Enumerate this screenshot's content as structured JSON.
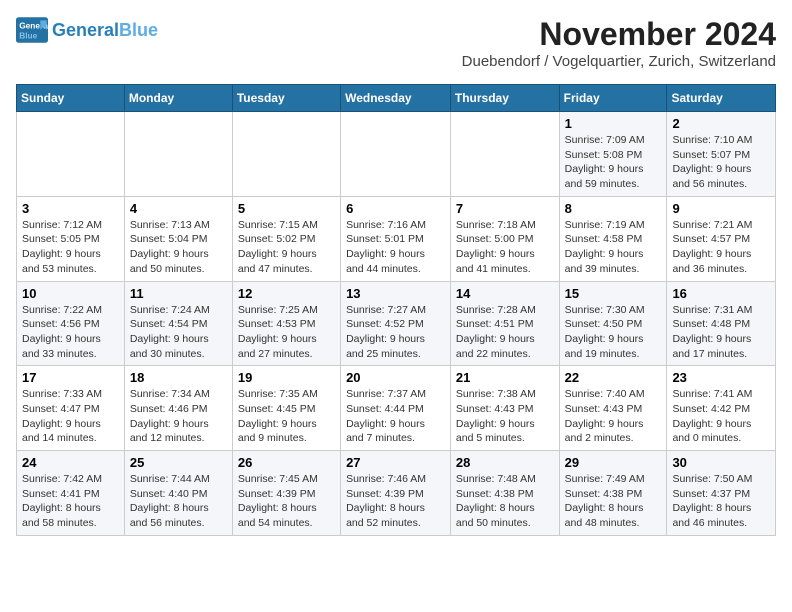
{
  "app": {
    "logo_general": "General",
    "logo_blue": "Blue",
    "month_title": "November 2024",
    "location": "Duebendorf / Vogelquartier, Zurich, Switzerland"
  },
  "calendar": {
    "headers": [
      "Sunday",
      "Monday",
      "Tuesday",
      "Wednesday",
      "Thursday",
      "Friday",
      "Saturday"
    ],
    "weeks": [
      [
        {
          "day": "",
          "info": ""
        },
        {
          "day": "",
          "info": ""
        },
        {
          "day": "",
          "info": ""
        },
        {
          "day": "",
          "info": ""
        },
        {
          "day": "",
          "info": ""
        },
        {
          "day": "1",
          "info": "Sunrise: 7:09 AM\nSunset: 5:08 PM\nDaylight: 9 hours and 59 minutes."
        },
        {
          "day": "2",
          "info": "Sunrise: 7:10 AM\nSunset: 5:07 PM\nDaylight: 9 hours and 56 minutes."
        }
      ],
      [
        {
          "day": "3",
          "info": "Sunrise: 7:12 AM\nSunset: 5:05 PM\nDaylight: 9 hours and 53 minutes."
        },
        {
          "day": "4",
          "info": "Sunrise: 7:13 AM\nSunset: 5:04 PM\nDaylight: 9 hours and 50 minutes."
        },
        {
          "day": "5",
          "info": "Sunrise: 7:15 AM\nSunset: 5:02 PM\nDaylight: 9 hours and 47 minutes."
        },
        {
          "day": "6",
          "info": "Sunrise: 7:16 AM\nSunset: 5:01 PM\nDaylight: 9 hours and 44 minutes."
        },
        {
          "day": "7",
          "info": "Sunrise: 7:18 AM\nSunset: 5:00 PM\nDaylight: 9 hours and 41 minutes."
        },
        {
          "day": "8",
          "info": "Sunrise: 7:19 AM\nSunset: 4:58 PM\nDaylight: 9 hours and 39 minutes."
        },
        {
          "day": "9",
          "info": "Sunrise: 7:21 AM\nSunset: 4:57 PM\nDaylight: 9 hours and 36 minutes."
        }
      ],
      [
        {
          "day": "10",
          "info": "Sunrise: 7:22 AM\nSunset: 4:56 PM\nDaylight: 9 hours and 33 minutes."
        },
        {
          "day": "11",
          "info": "Sunrise: 7:24 AM\nSunset: 4:54 PM\nDaylight: 9 hours and 30 minutes."
        },
        {
          "day": "12",
          "info": "Sunrise: 7:25 AM\nSunset: 4:53 PM\nDaylight: 9 hours and 27 minutes."
        },
        {
          "day": "13",
          "info": "Sunrise: 7:27 AM\nSunset: 4:52 PM\nDaylight: 9 hours and 25 minutes."
        },
        {
          "day": "14",
          "info": "Sunrise: 7:28 AM\nSunset: 4:51 PM\nDaylight: 9 hours and 22 minutes."
        },
        {
          "day": "15",
          "info": "Sunrise: 7:30 AM\nSunset: 4:50 PM\nDaylight: 9 hours and 19 minutes."
        },
        {
          "day": "16",
          "info": "Sunrise: 7:31 AM\nSunset: 4:48 PM\nDaylight: 9 hours and 17 minutes."
        }
      ],
      [
        {
          "day": "17",
          "info": "Sunrise: 7:33 AM\nSunset: 4:47 PM\nDaylight: 9 hours and 14 minutes."
        },
        {
          "day": "18",
          "info": "Sunrise: 7:34 AM\nSunset: 4:46 PM\nDaylight: 9 hours and 12 minutes."
        },
        {
          "day": "19",
          "info": "Sunrise: 7:35 AM\nSunset: 4:45 PM\nDaylight: 9 hours and 9 minutes."
        },
        {
          "day": "20",
          "info": "Sunrise: 7:37 AM\nSunset: 4:44 PM\nDaylight: 9 hours and 7 minutes."
        },
        {
          "day": "21",
          "info": "Sunrise: 7:38 AM\nSunset: 4:43 PM\nDaylight: 9 hours and 5 minutes."
        },
        {
          "day": "22",
          "info": "Sunrise: 7:40 AM\nSunset: 4:43 PM\nDaylight: 9 hours and 2 minutes."
        },
        {
          "day": "23",
          "info": "Sunrise: 7:41 AM\nSunset: 4:42 PM\nDaylight: 9 hours and 0 minutes."
        }
      ],
      [
        {
          "day": "24",
          "info": "Sunrise: 7:42 AM\nSunset: 4:41 PM\nDaylight: 8 hours and 58 minutes."
        },
        {
          "day": "25",
          "info": "Sunrise: 7:44 AM\nSunset: 4:40 PM\nDaylight: 8 hours and 56 minutes."
        },
        {
          "day": "26",
          "info": "Sunrise: 7:45 AM\nSunset: 4:39 PM\nDaylight: 8 hours and 54 minutes."
        },
        {
          "day": "27",
          "info": "Sunrise: 7:46 AM\nSunset: 4:39 PM\nDaylight: 8 hours and 52 minutes."
        },
        {
          "day": "28",
          "info": "Sunrise: 7:48 AM\nSunset: 4:38 PM\nDaylight: 8 hours and 50 minutes."
        },
        {
          "day": "29",
          "info": "Sunrise: 7:49 AM\nSunset: 4:38 PM\nDaylight: 8 hours and 48 minutes."
        },
        {
          "day": "30",
          "info": "Sunrise: 7:50 AM\nSunset: 4:37 PM\nDaylight: 8 hours and 46 minutes."
        }
      ]
    ]
  }
}
